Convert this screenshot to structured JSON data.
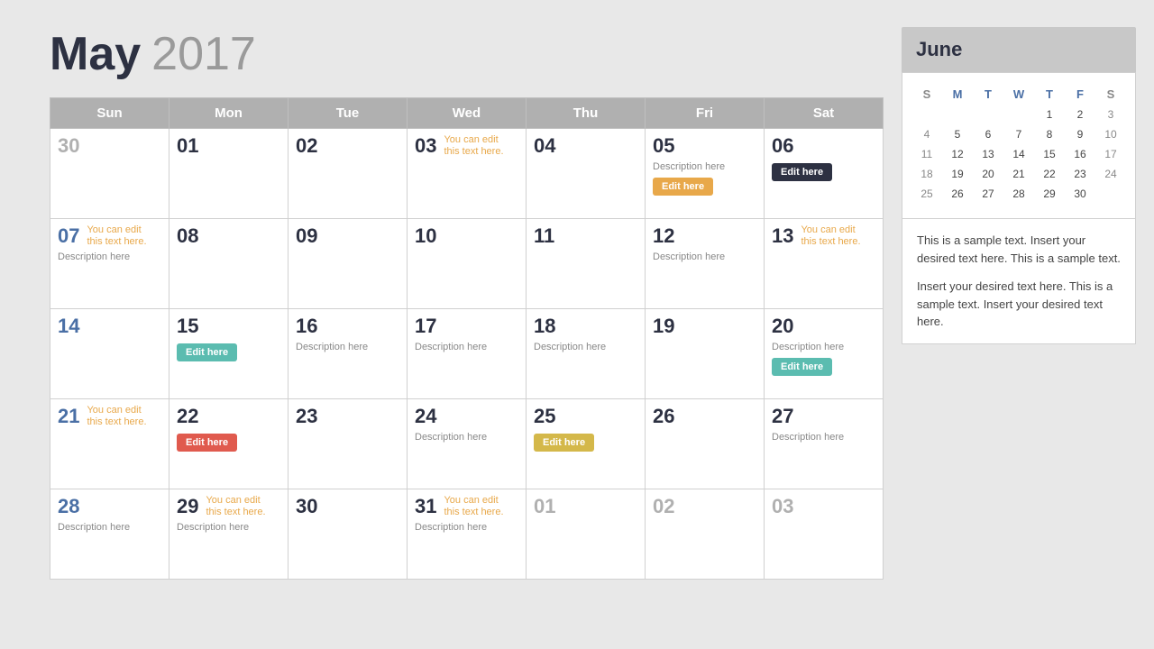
{
  "header": {
    "month": "May",
    "year": "2017"
  },
  "weekdays": [
    "Sun",
    "Mon",
    "Tue",
    "Wed",
    "Thu",
    "Fri",
    "Sat"
  ],
  "weeks": [
    [
      {
        "num": "30",
        "style": "gray",
        "edit": null,
        "desc": null,
        "btn": null
      },
      {
        "num": "01",
        "style": "dark",
        "edit": null,
        "desc": null,
        "btn": null
      },
      {
        "num": "02",
        "style": "dark",
        "edit": null,
        "desc": null,
        "btn": null
      },
      {
        "num": "03",
        "style": "dark",
        "edit": "You can edit\nthis text here.",
        "desc": null,
        "btn": null
      },
      {
        "num": "04",
        "style": "dark",
        "edit": null,
        "desc": null,
        "btn": null
      },
      {
        "num": "05",
        "style": "dark",
        "edit": null,
        "desc": "Description here",
        "btn": {
          "label": "Edit here",
          "color": "orange"
        }
      },
      {
        "num": "06",
        "style": "dark",
        "edit": null,
        "desc": null,
        "btn": {
          "label": "Edit here",
          "color": "dark"
        }
      }
    ],
    [
      {
        "num": "07",
        "style": "blue",
        "edit": "You can edit\nthis text here.",
        "desc": "Description here",
        "btn": null
      },
      {
        "num": "08",
        "style": "dark",
        "edit": null,
        "desc": null,
        "btn": null
      },
      {
        "num": "09",
        "style": "dark",
        "edit": null,
        "desc": null,
        "btn": null
      },
      {
        "num": "10",
        "style": "dark",
        "edit": null,
        "desc": null,
        "btn": null
      },
      {
        "num": "11",
        "style": "dark",
        "edit": null,
        "desc": null,
        "btn": null
      },
      {
        "num": "12",
        "style": "dark",
        "edit": null,
        "desc": "Description here",
        "btn": null
      },
      {
        "num": "13",
        "style": "dark",
        "edit": "You can edit\nthis text here.",
        "desc": null,
        "btn": null
      }
    ],
    [
      {
        "num": "14",
        "style": "blue",
        "edit": null,
        "desc": null,
        "btn": null
      },
      {
        "num": "15",
        "style": "dark",
        "edit": null,
        "desc": null,
        "btn": {
          "label": "Edit here",
          "color": "teal"
        }
      },
      {
        "num": "16",
        "style": "dark",
        "edit": null,
        "desc": "Description here",
        "btn": null
      },
      {
        "num": "17",
        "style": "dark",
        "edit": null,
        "desc": "Description here",
        "btn": null
      },
      {
        "num": "18",
        "style": "dark",
        "edit": null,
        "desc": "Description here",
        "btn": null
      },
      {
        "num": "19",
        "style": "dark",
        "edit": null,
        "desc": null,
        "btn": null
      },
      {
        "num": "20",
        "style": "dark",
        "edit": null,
        "desc": "Description here",
        "btn": {
          "label": "Edit here",
          "color": "teal"
        }
      }
    ],
    [
      {
        "num": "21",
        "style": "blue",
        "edit": "You can edit\nthis text here.",
        "desc": null,
        "btn": null
      },
      {
        "num": "22",
        "style": "dark",
        "edit": null,
        "desc": null,
        "btn": {
          "label": "Edit here",
          "color": "red"
        }
      },
      {
        "num": "23",
        "style": "dark",
        "edit": null,
        "desc": null,
        "btn": null
      },
      {
        "num": "24",
        "style": "dark",
        "edit": null,
        "desc": "Description here",
        "btn": null
      },
      {
        "num": "25",
        "style": "dark",
        "edit": null,
        "desc": null,
        "btn": {
          "label": "Edit here",
          "color": "yellow"
        }
      },
      {
        "num": "26",
        "style": "dark",
        "edit": null,
        "desc": null,
        "btn": null
      },
      {
        "num": "27",
        "style": "dark",
        "edit": null,
        "desc": "Description here",
        "btn": null
      }
    ],
    [
      {
        "num": "28",
        "style": "blue",
        "edit": null,
        "desc": "Description here",
        "btn": null
      },
      {
        "num": "29",
        "style": "dark",
        "edit": "You can edit\nthis text here.",
        "desc": "Description here",
        "btn": null
      },
      {
        "num": "30",
        "style": "dark",
        "edit": null,
        "desc": null,
        "btn": null
      },
      {
        "num": "31",
        "style": "dark",
        "edit": "You can edit\nthis text here.",
        "desc": "Description here",
        "btn": null
      },
      {
        "num": "01",
        "style": "gray",
        "edit": null,
        "desc": null,
        "btn": null
      },
      {
        "num": "02",
        "style": "gray",
        "edit": null,
        "desc": null,
        "btn": null
      },
      {
        "num": "03",
        "style": "gray",
        "edit": null,
        "desc": null,
        "btn": null
      }
    ]
  ],
  "sidebar": {
    "june_header": "June",
    "mini_cal": {
      "headers": [
        "S",
        "M",
        "T",
        "W",
        "T",
        "F",
        "S"
      ],
      "rows": [
        [
          "",
          "",
          "",
          "",
          "1",
          "2",
          "3"
        ],
        [
          "4",
          "5",
          "6",
          "7",
          "8",
          "9",
          "10"
        ],
        [
          "11",
          "12",
          "13",
          "14",
          "15",
          "16",
          "17"
        ],
        [
          "18",
          "19",
          "20",
          "21",
          "22",
          "23",
          "24"
        ],
        [
          "25",
          "26",
          "27",
          "28",
          "29",
          "30",
          ""
        ]
      ]
    },
    "text1": "This is a sample text. Insert your desired text here. This is a sample text.",
    "text2": "Insert your desired text here. This is a sample text. Insert your desired text here."
  }
}
